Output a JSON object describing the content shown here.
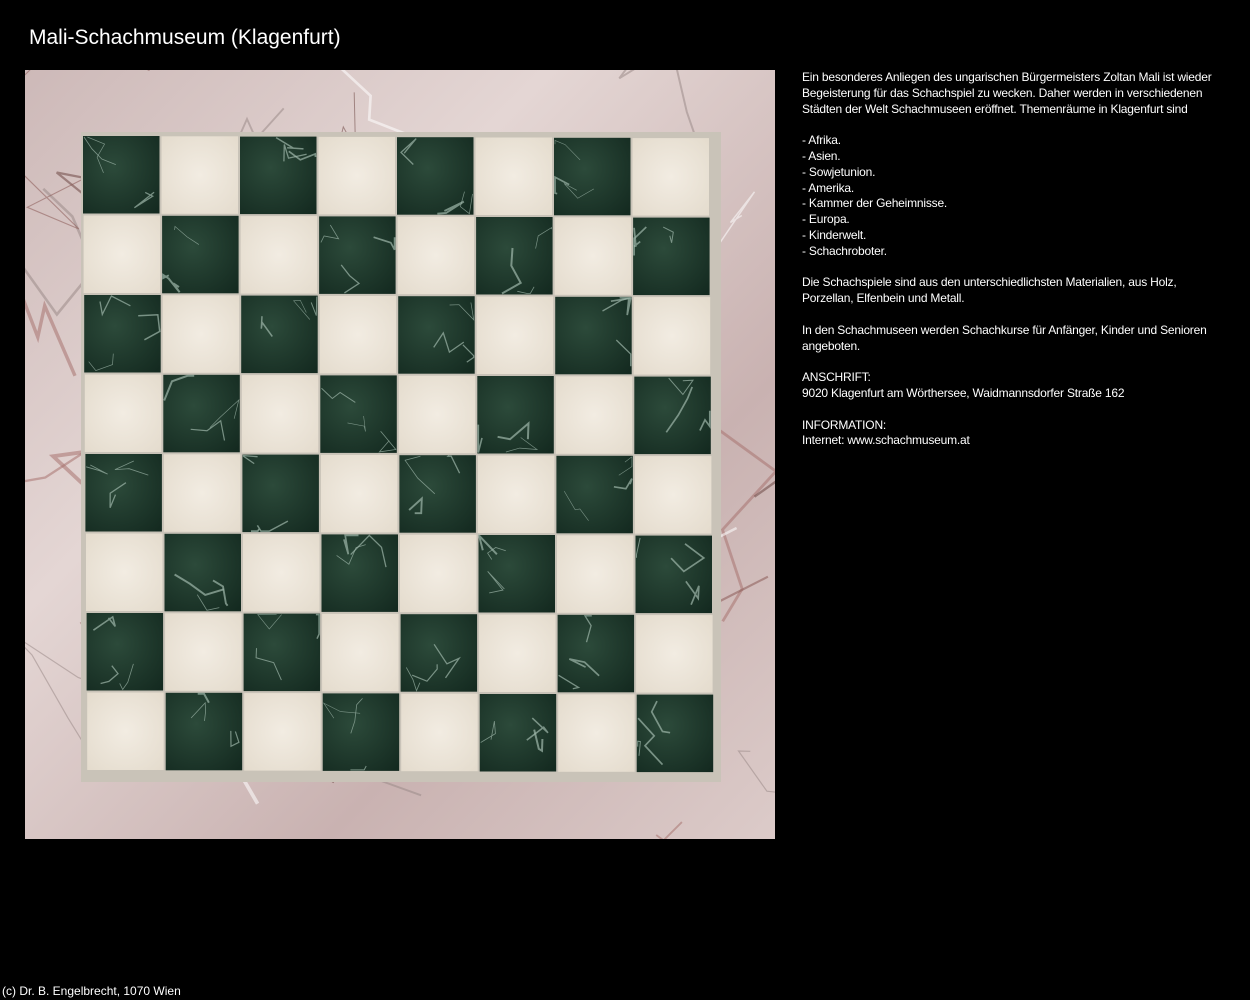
{
  "title": "Mali-Schachmuseum (Klagenfurt)",
  "photo": {
    "subject": "marble-chessboard",
    "colors": {
      "dark_square": "#1f3a2c",
      "light_square": "#ede6d9",
      "border_marble": "#d9c8c6",
      "marble_vein": "#8a5a56"
    }
  },
  "description": {
    "intro": "Ein besonderes Anliegen des ungarischen Bürgermeisters Zoltan Mali ist wieder Begeisterung für das Schachspiel zu wecken. Daher werden in verschiedenen Städten der Welt Schachmuseen eröffnet. Themenräume in Klagenfurt sind",
    "rooms": [
      "- Afrika.",
      "- Asien.",
      "- Sowjetunion.",
      "- Amerika.",
      "- Kammer der Geheimnisse.",
      "- Europa.",
      "- Kinderwelt.",
      "- Schachroboter."
    ],
    "materials": "Die Schachspiele sind aus den unterschiedlichsten Materialien, aus Holz, Porzellan, Elfenbein und Metall.",
    "courses": "In den Schachmuseen werden Schachkurse für Anfänger, Kinder und Senioren angeboten.",
    "address_label": "ANSCHRIFT:",
    "address": "9020 Klagenfurt am Wörthersee, Waidmannsdorfer Straße 162",
    "info_label": "INFORMATION:",
    "info": "Internet: www.schachmuseum.at"
  },
  "footer": "(c) Dr. B. Engelbrecht, 1070 Wien"
}
